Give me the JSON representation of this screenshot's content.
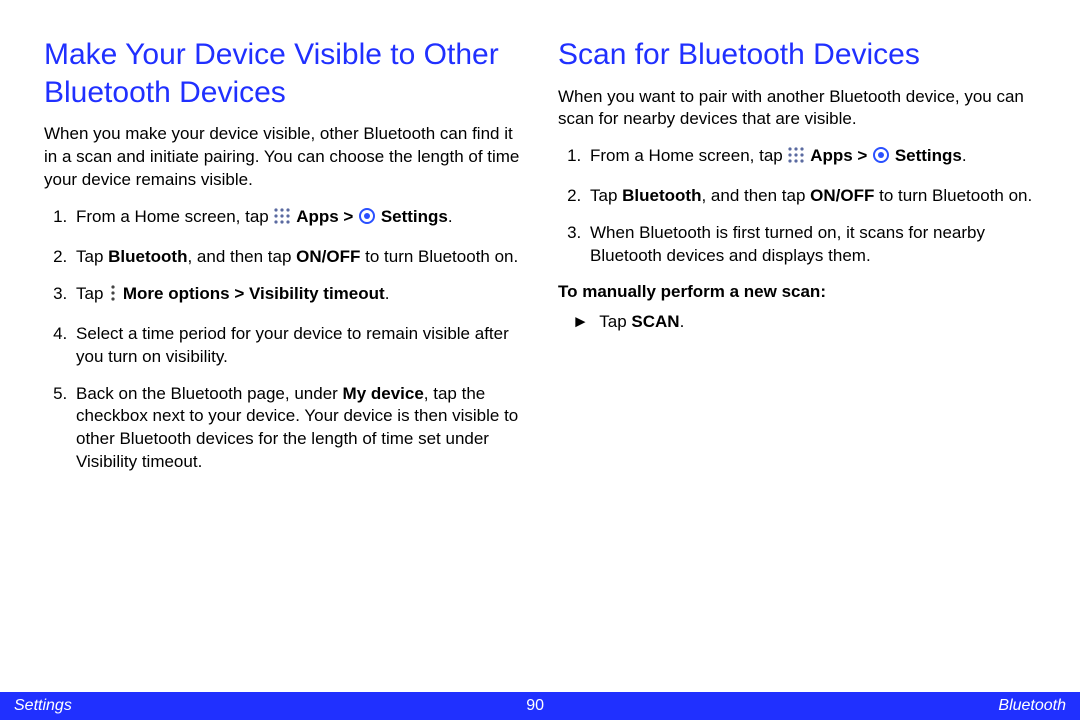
{
  "left": {
    "title": "Make Your Device Visible to Other Bluetooth Devices",
    "intro": "When you make your device visible, other Bluetooth can find it in a scan and initiate pairing. You can choose the length of time your device remains visible.",
    "step1_a": "From a Home screen, tap ",
    "step1_apps": "Apps > ",
    "step1_settings": "Settings",
    "step2_a": "Tap ",
    "step2_bt": "Bluetooth",
    "step2_b": ", and then tap ",
    "step2_onoff": "ON/OFF",
    "step2_c": " to turn Bluetooth on.",
    "step3_a": "Tap ",
    "step3_more": "More options > Visibility timeout",
    "step4": "Select a time period for your device to remain visible after you turn on visibility.",
    "step5_a": "Back on the Bluetooth page, under ",
    "step5_mydevice": "My device",
    "step5_b": ", tap the checkbox next to your device. Your device is then visible to other Bluetooth devices for the length of time set under Visibility timeout."
  },
  "right": {
    "title": "Scan for Bluetooth Devices",
    "intro": "When you want to pair with another Bluetooth device, you can scan for nearby devices that are visible.",
    "step1_a": "From a Home screen, tap ",
    "step1_apps": "Apps > ",
    "step1_settings": "Settings",
    "step2_a": "Tap ",
    "step2_bt": "Bluetooth",
    "step2_b": ", and then tap ",
    "step2_onoff": "ON/OFF",
    "step2_c": " to turn Bluetooth on.",
    "step3": "When Bluetooth is first turned on, it scans for nearby Bluetooth devices and displays them.",
    "subhead": "To manually perform a new scan:",
    "scan_a": "Tap ",
    "scan_b": "SCAN",
    "marker": "►"
  },
  "footer": {
    "left": "Settings",
    "page": "90",
    "right": "Bluetooth"
  }
}
